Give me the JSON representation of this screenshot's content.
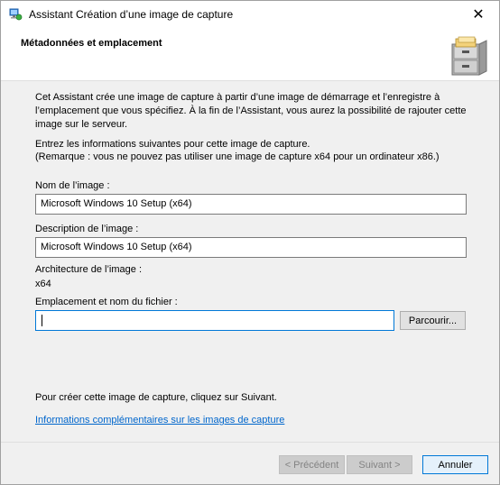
{
  "window": {
    "title": "Assistant Création d’une image de capture",
    "close_glyph": "✕"
  },
  "header": {
    "title": "Métadonnées et emplacement",
    "icon": "file-cabinet-icon"
  },
  "intro": {
    "text": "Cet Assistant crée une image de capture à partir d’une image de démarrage et l’enregistre à l’emplacement que vous spécifiez. À la fin de l’Assistant, vous aurez la possibilité de rajouter cette image sur le serveur.",
    "instructions_line1": "Entrez les informations suivantes pour cette image de capture.",
    "instructions_line2": "(Remarque : vous ne pouvez pas utiliser une image de capture x64 pour un ordinateur x86.)"
  },
  "fields": {
    "image_name_label": "Nom de l’image :",
    "image_name_value": "Microsoft Windows 10 Setup (x64)",
    "image_description_label": "Description de l’image :",
    "image_description_value": "Microsoft Windows 10 Setup (x64)",
    "architecture_label": "Architecture de l’image :",
    "architecture_value": "x64",
    "location_label": "Emplacement et nom du fichier :",
    "location_value": "",
    "browse_label": "Parcourir..."
  },
  "footer": {
    "next_hint": "Pour créer cette image de capture, cliquez sur Suivant.",
    "more_info_link": "Informations complémentaires sur les images de capture",
    "previous_label": "< Précédent",
    "next_label": "Suivant >",
    "cancel_label": "Annuler"
  }
}
